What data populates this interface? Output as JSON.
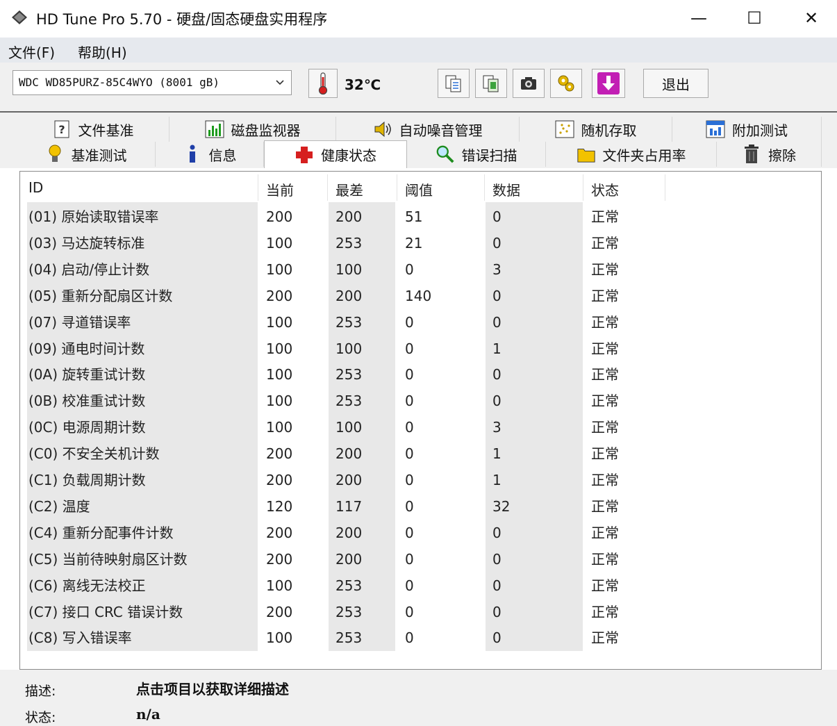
{
  "window": {
    "title": "HD Tune Pro 5.70 - 硬盘/固态硬盘实用程序",
    "minimize": "—",
    "maximize": "☐",
    "close": "✕"
  },
  "menu": {
    "items": [
      {
        "label": "文件(F)"
      },
      {
        "label": "帮助(H)"
      }
    ]
  },
  "toolbar": {
    "drive": "WDC WD85PURZ-85C4WYO (8001 gB)",
    "temperature": "32℃",
    "exit": "退出",
    "icons": [
      "thermometer-icon",
      "copy-text-icon",
      "copy-screenshot-icon",
      "camera-icon",
      "options-icon",
      "save-download-icon"
    ]
  },
  "tabs": {
    "row1": [
      {
        "label": "文件基准",
        "icon": "file-benchmark-icon"
      },
      {
        "label": "磁盘监视器",
        "icon": "disk-monitor-icon"
      },
      {
        "label": "自动噪音管理",
        "icon": "speaker-icon"
      },
      {
        "label": "随机存取",
        "icon": "random-access-icon"
      },
      {
        "label": "附加测试",
        "icon": "extra-tests-icon"
      }
    ],
    "row2": [
      {
        "label": "基准测试",
        "icon": "benchmark-bulb-icon"
      },
      {
        "label": "信息",
        "icon": "info-icon"
      },
      {
        "label": "健康状态",
        "icon": "health-cross-icon",
        "active": true
      },
      {
        "label": "错误扫描",
        "icon": "magnifier-icon"
      },
      {
        "label": "文件夹占用率",
        "icon": "folder-icon"
      },
      {
        "label": "擦除",
        "icon": "trash-icon"
      }
    ]
  },
  "table": {
    "headers": [
      "ID",
      "当前",
      "最差",
      "阈值",
      "数据",
      "状态"
    ],
    "rows": [
      [
        "(01) 原始读取错误率",
        "200",
        "200",
        "51",
        "0",
        "正常"
      ],
      [
        "(03) 马达旋转标准",
        "100",
        "253",
        "21",
        "0",
        "正常"
      ],
      [
        "(04) 启动/停止计数",
        "100",
        "100",
        "0",
        "3",
        "正常"
      ],
      [
        "(05) 重新分配扇区计数",
        "200",
        "200",
        "140",
        "0",
        "正常"
      ],
      [
        "(07) 寻道错误率",
        "100",
        "253",
        "0",
        "0",
        "正常"
      ],
      [
        "(09) 通电时间计数",
        "100",
        "100",
        "0",
        "1",
        "正常"
      ],
      [
        "(0A) 旋转重试计数",
        "100",
        "253",
        "0",
        "0",
        "正常"
      ],
      [
        "(0B) 校准重试计数",
        "100",
        "253",
        "0",
        "0",
        "正常"
      ],
      [
        "(0C) 电源周期计数",
        "100",
        "100",
        "0",
        "3",
        "正常"
      ],
      [
        "(C0) 不安全关机计数",
        "200",
        "200",
        "0",
        "1",
        "正常"
      ],
      [
        "(C1) 负载周期计数",
        "200",
        "200",
        "0",
        "1",
        "正常"
      ],
      [
        "(C2) 温度",
        "120",
        "117",
        "0",
        "32",
        "正常"
      ],
      [
        "(C4) 重新分配事件计数",
        "200",
        "200",
        "0",
        "0",
        "正常"
      ],
      [
        "(C5) 当前待映射扇区计数",
        "200",
        "200",
        "0",
        "0",
        "正常"
      ],
      [
        "(C6) 离线无法校正",
        "100",
        "253",
        "0",
        "0",
        "正常"
      ],
      [
        "(C7) 接口 CRC 错误计数",
        "200",
        "253",
        "0",
        "0",
        "正常"
      ],
      [
        "(C8) 写入错误率",
        "100",
        "253",
        "0",
        "0",
        "正常"
      ]
    ]
  },
  "footer": {
    "desc_label": "描述:",
    "desc_value": "点击项目以获取详细描述",
    "status_label": "状态:",
    "status_value": "n/a"
  }
}
